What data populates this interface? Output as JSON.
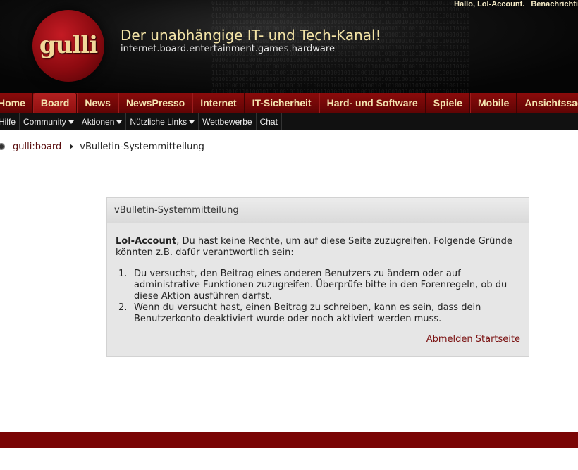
{
  "header": {
    "welcome_greeting": "Hallo, Lol-Account.",
    "welcome_notifications": "Benachrichti",
    "logo_text": "gulli",
    "title": "Der unabhängige IT- und Tech-Kanal!",
    "subtitle": "internet.board.entertainment.games.hardware"
  },
  "mainnav": [
    {
      "label": "Home"
    },
    {
      "label": "Board",
      "active": true
    },
    {
      "label": "News"
    },
    {
      "label": "NewsPresso"
    },
    {
      "label": "Internet"
    },
    {
      "label": "IT-Sicherheit"
    },
    {
      "label": "Hard- und Software"
    },
    {
      "label": "Spiele"
    },
    {
      "label": "Mobile"
    },
    {
      "label": "Ansichtssach"
    }
  ],
  "subnav": [
    {
      "label": "Hilfe"
    },
    {
      "label": "Community",
      "dropdown": true
    },
    {
      "label": "Aktionen",
      "dropdown": true
    },
    {
      "label": "Nützliche Links",
      "dropdown": true
    },
    {
      "label": "Wettbewerbe"
    },
    {
      "label": "Chat"
    }
  ],
  "breadcrumb": {
    "icon": "home-icon",
    "link": "gulli:board",
    "current": "vBulletin-Systemmitteilung"
  },
  "message": {
    "title": "vBulletin-Systemmitteilung",
    "username": "Lol-Account",
    "intro": ", Du hast keine Rechte, um auf diese Seite zuzugreifen. Folgende Gründe könnten z.B. dafür verantwortlich sein:",
    "reasons": [
      "Du versuchst, den Beitrag eines anderen Benutzers zu ändern oder auf administrative Funktionen zuzugreifen. Überprüfe bitte in den Forenregeln, ob du diese Aktion ausführen darfst.",
      "Wenn du versucht hast, einen Beitrag zu schreiben, kann es sein, dass dein Benutzerkonto deaktiviert wurde oder noch aktiviert werden muss."
    ],
    "logout_label": "Abmelden",
    "home_label": "Startseite"
  },
  "colors": {
    "nav_red": "#7a0505",
    "link_dark_red": "#7a1010",
    "title_gold": "#f3e3a6"
  }
}
